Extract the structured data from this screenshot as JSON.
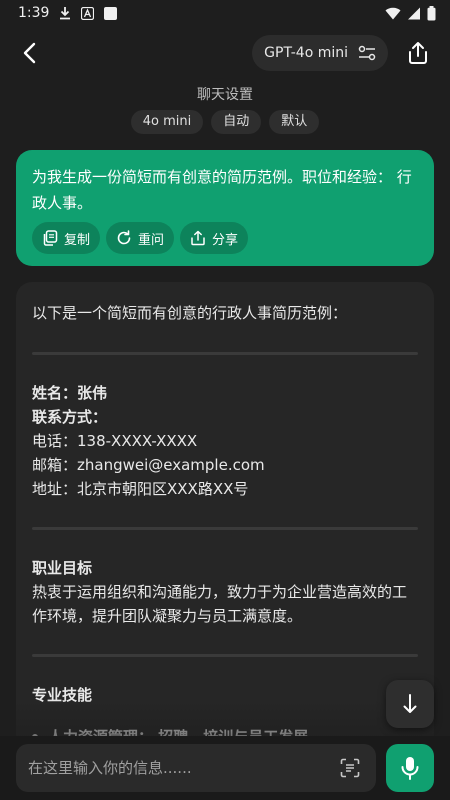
{
  "status_bar": {
    "time": "1:39"
  },
  "header": {
    "model_label": "GPT-4o mini"
  },
  "chat_settings": {
    "label": "聊天设置",
    "chips": [
      "4o mini",
      "自动",
      "默认"
    ]
  },
  "user_message": {
    "text": "为我生成一份简短而有创意的简历范例。职位和经验： 行政人事。",
    "actions": {
      "copy": "复制",
      "retry": "重问",
      "share": "分享"
    }
  },
  "ai_message": {
    "intro": "以下是一个简短而有创意的行政人事简历范例：",
    "contact": {
      "name": "姓名：张伟",
      "heading": "联系方式：",
      "phone": "电话：138-XXXX-XXXX",
      "email": "邮箱：zhangwei@example.com",
      "address": "地址：北京市朝阳区XXX路XX号"
    },
    "objective": {
      "heading": "职业目标",
      "text": "热衷于运用组织和沟通能力，致力于为企业营造高效的工作环境，提升团队凝聚力与员工满意度。"
    },
    "skills": {
      "heading": "专业技能",
      "first_item": "人力资源管理： 招聘、培训与员工发展"
    }
  },
  "input": {
    "placeholder": "在这里输入你的信息......"
  },
  "colors": {
    "accent": "#10a070",
    "background": "#1e1e1e",
    "card": "#262626"
  }
}
